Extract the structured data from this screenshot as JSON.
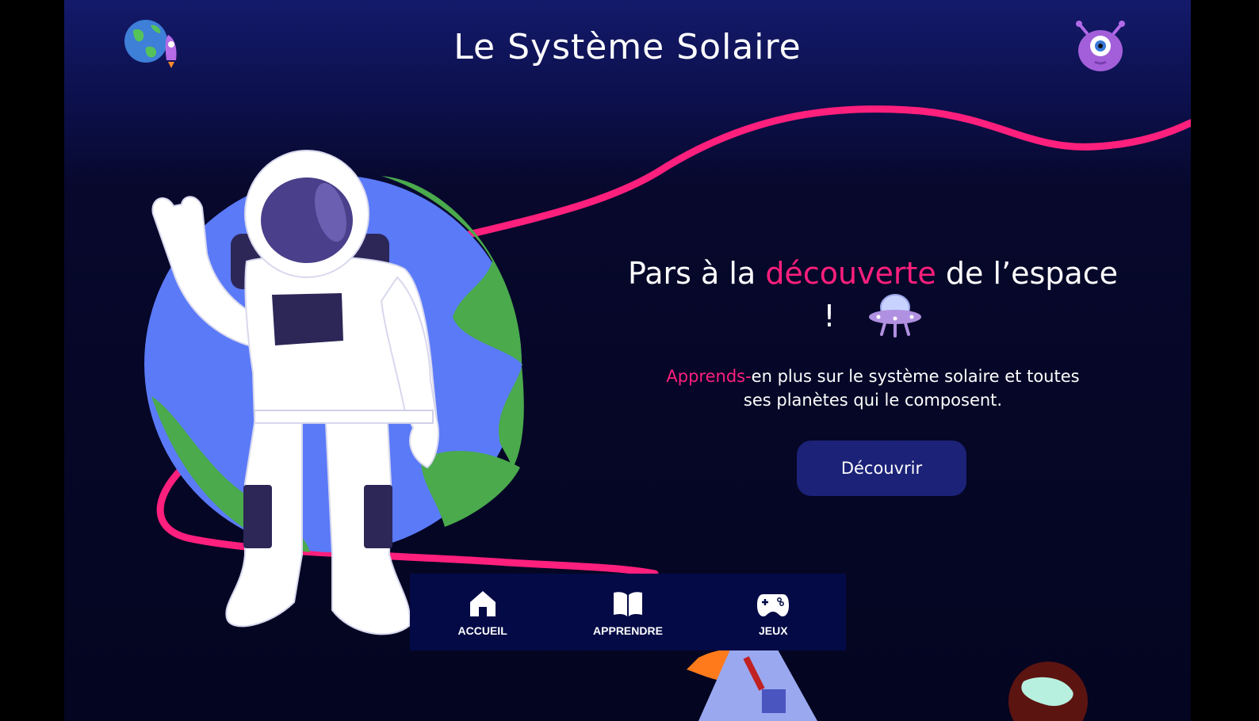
{
  "header": {
    "title": "Le Système Solaire",
    "logo_icon": "earth-rocket-icon",
    "profile_icon": "alien-icon"
  },
  "hero": {
    "title_before": "Pars à la ",
    "title_accent": "découverte",
    "title_after": " de l’espace !",
    "text_accent": "Apprends-",
    "text_rest": "en plus sur le système solaire et toutes ses planètes qui le composent.",
    "cta_label": "Découvrir",
    "ufo_icon": "ufo-icon"
  },
  "nav": {
    "items": [
      {
        "label": "ACCUEIL",
        "icon": "home-icon"
      },
      {
        "label": "APPRENDRE",
        "icon": "book-icon"
      },
      {
        "label": "JEUX",
        "icon": "gamepad-icon"
      }
    ]
  },
  "colors": {
    "background": "#07082c",
    "accent": "#ff1f7d",
    "button": "#1b2278",
    "nav_bg": "#030a46",
    "earth_ocean": "#5a7af8",
    "earth_land": "#4aaa4c"
  }
}
